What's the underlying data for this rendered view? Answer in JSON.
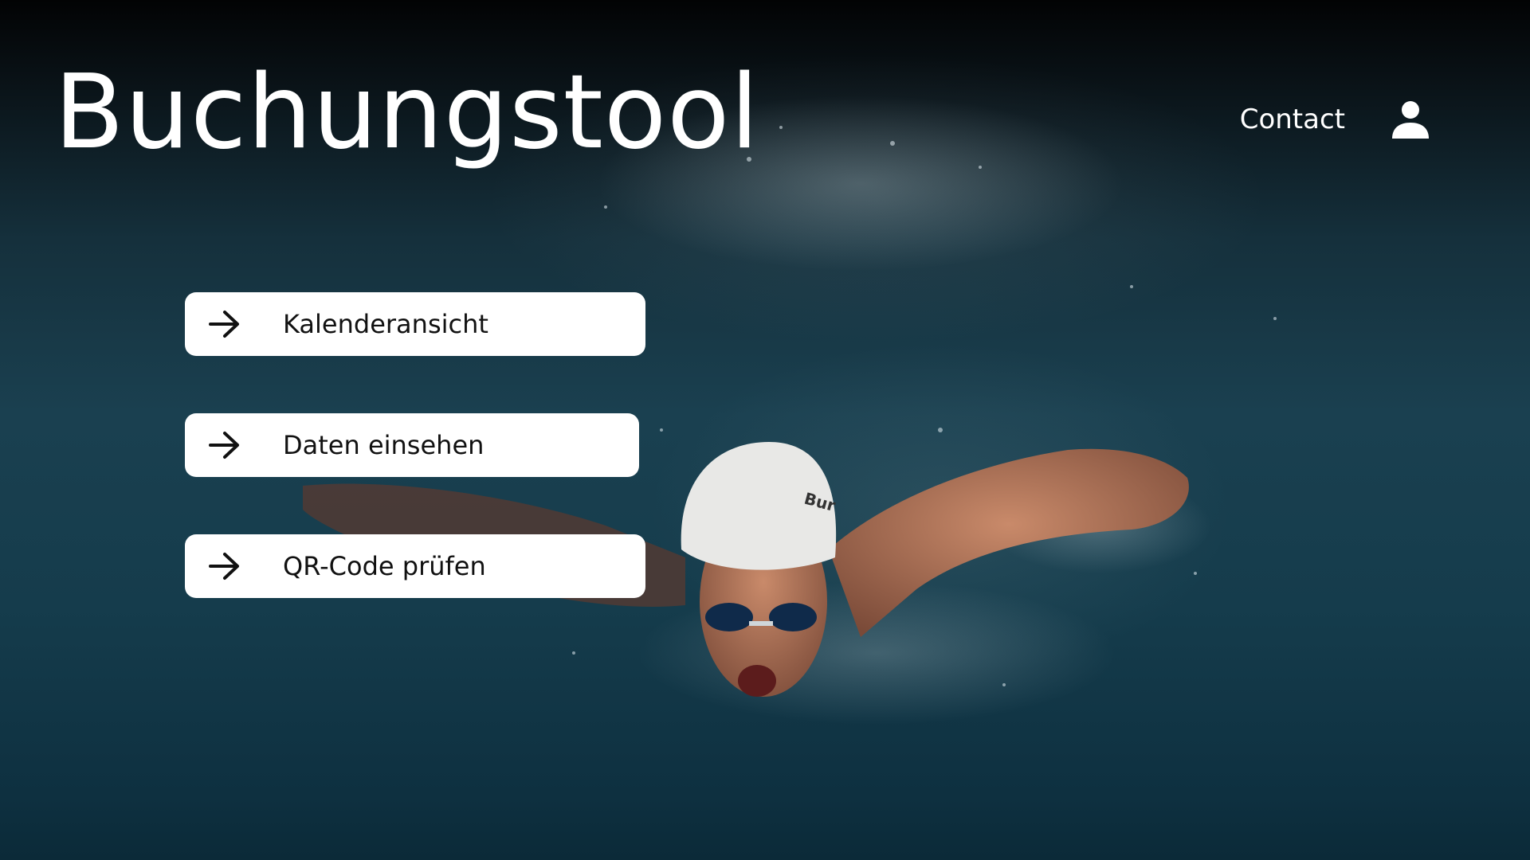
{
  "header": {
    "title": "Buchungstool",
    "contact_label": "Contact",
    "user_icon": "user-icon"
  },
  "menu": {
    "items": [
      {
        "label": "Kalenderansicht",
        "icon": "arrow-right-icon"
      },
      {
        "label": "Daten einsehen",
        "icon": "arrow-right-icon"
      },
      {
        "label": "QR-Code prüfen",
        "icon": "arrow-right-icon"
      }
    ]
  },
  "background": {
    "image": "swimmer butterfly stroke photo",
    "colors": {
      "water": "#1a4050",
      "top": "#020304"
    }
  }
}
